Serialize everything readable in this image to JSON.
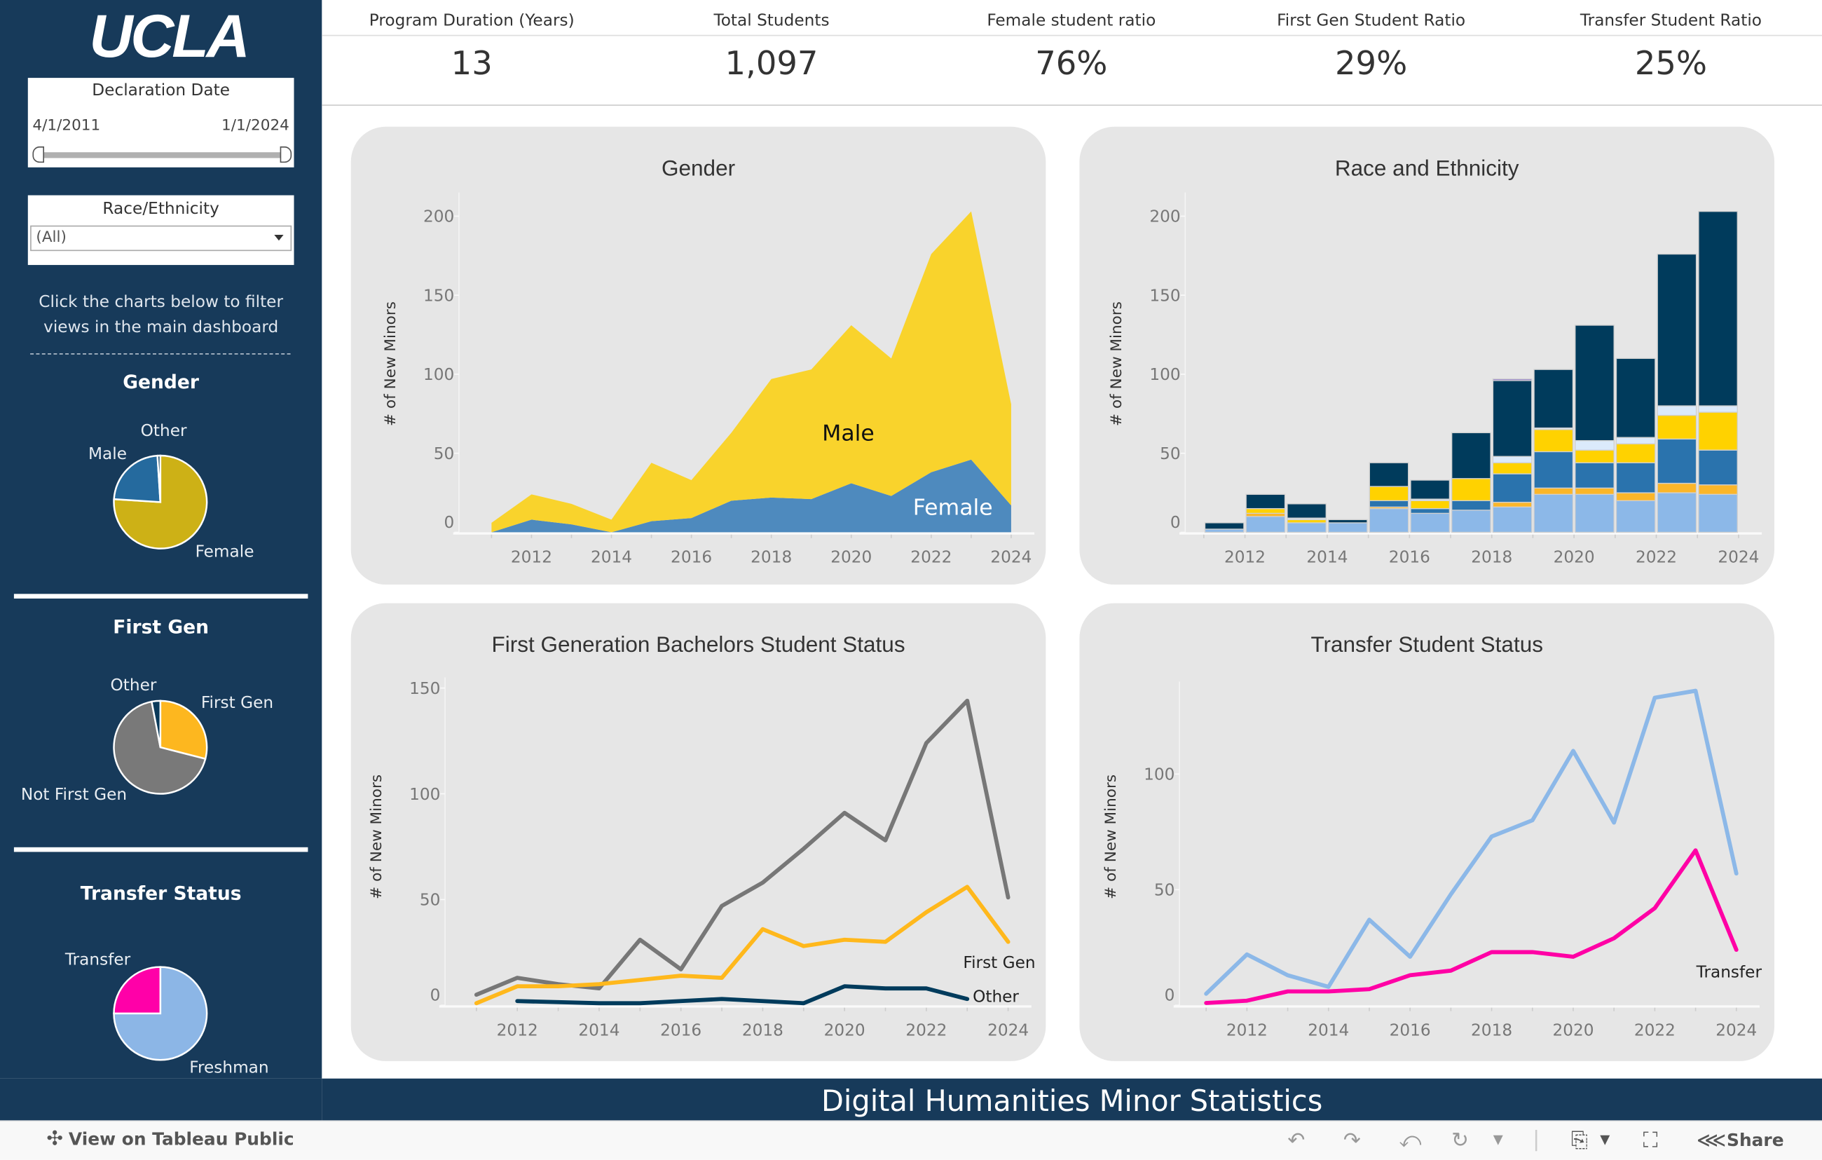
{
  "sidebar": {
    "logo": "UCLA",
    "declaration_filter": {
      "title": "Declaration Date",
      "start": "4/1/2011",
      "end": "1/1/2024"
    },
    "race_filter": {
      "title": "Race/Ethnicity",
      "value": "(All)"
    },
    "hint_line1": "Click the charts below to filter",
    "hint_line2": "views in the main dashboard",
    "gender_pie": {
      "title": "Gender",
      "slices": [
        {
          "label": "Female",
          "value": 76,
          "color": "#cdb116"
        },
        {
          "label": "Male",
          "value": 23,
          "color": "#256a9e"
        },
        {
          "label": "Other",
          "value": 1,
          "color": "#0a3a5a"
        }
      ]
    },
    "firstgen_pie": {
      "title": "First Gen",
      "slices": [
        {
          "label": "First Gen",
          "value": 29,
          "color": "#fdb71f"
        },
        {
          "label": "Not First Gen",
          "value": 68,
          "color": "#797979"
        },
        {
          "label": "Other",
          "value": 3,
          "color": "#0a3a5a"
        }
      ]
    },
    "transfer_pie": {
      "title": "Transfer Status",
      "slices": [
        {
          "label": "Freshman",
          "value": 75,
          "color": "#8cb6e6"
        },
        {
          "label": "Transfer",
          "value": 25,
          "color": "#ff00a8"
        }
      ]
    }
  },
  "kpis": [
    {
      "label": "Program Duration (Years)",
      "value": "13"
    },
    {
      "label": "Total Students",
      "value": "1,097"
    },
    {
      "label": "Female student ratio",
      "value": "76%"
    },
    {
      "label": "First Gen Student Ratio",
      "value": "29%"
    },
    {
      "label": "Transfer Student Ratio",
      "value": "25%"
    }
  ],
  "chart_data": [
    {
      "title": "Gender",
      "type": "area",
      "stacked": true,
      "ylabel": "# of New Minors",
      "ylim": [
        0,
        215
      ],
      "yticks": [
        "0",
        "50",
        "100",
        "150",
        "200"
      ],
      "xticks": [
        "2012",
        "2014",
        "2016",
        "2018",
        "2020",
        "2022",
        "2024"
      ],
      "x": [
        2011,
        2012,
        2013,
        2014,
        2015,
        2016,
        2017,
        2018,
        2019,
        2020,
        2021,
        2022,
        2023,
        2024
      ],
      "series": [
        {
          "name": "Male",
          "color": "#4e8abe",
          "values": [
            0,
            8,
            5,
            0,
            7,
            9,
            20,
            22,
            21,
            31,
            23,
            38,
            46,
            17
          ]
        },
        {
          "name": "Female",
          "color": "#f9d32c",
          "values": [
            6,
            16,
            13,
            8,
            37,
            24,
            43,
            75,
            82,
            100,
            87,
            138,
            157,
            64
          ]
        }
      ]
    },
    {
      "title": "Race and Ethnicity",
      "type": "bar",
      "stacked": true,
      "ylabel": "# of New Minors",
      "ylim": [
        0,
        215
      ],
      "yticks": [
        "0",
        "50",
        "100",
        "150",
        "200"
      ],
      "xticks": [
        "2012",
        "2014",
        "2016",
        "2018",
        "2020",
        "2022",
        "2024"
      ],
      "categories": [
        2011,
        2012,
        2013,
        2014,
        2015,
        2016,
        2017,
        2018,
        2019,
        2020,
        2021,
        2022,
        2023
      ],
      "series": [
        {
          "color": "#8cb8e8",
          "values": [
            2,
            10,
            6,
            6,
            15,
            12,
            14,
            16,
            24,
            24,
            20,
            25,
            24
          ]
        },
        {
          "color": "#fbb629",
          "values": [
            0,
            2,
            0,
            0,
            1,
            0,
            0,
            3,
            4,
            4,
            5,
            6,
            6
          ]
        },
        {
          "color": "#2a73ad",
          "values": [
            0,
            0,
            0,
            0,
            4,
            3,
            6,
            18,
            23,
            16,
            19,
            28,
            22
          ]
        },
        {
          "color": "#ffd200",
          "values": [
            0,
            3,
            2,
            0,
            9,
            5,
            14,
            7,
            14,
            8,
            12,
            15,
            24
          ]
        },
        {
          "color": "#dbeafb",
          "values": [
            0,
            0,
            1,
            0,
            0,
            1,
            0,
            4,
            1,
            6,
            4,
            6,
            4
          ]
        },
        {
          "color": "#003b5c",
          "values": [
            4,
            9,
            9,
            2,
            15,
            12,
            29,
            48,
            37,
            73,
            50,
            96,
            123
          ]
        },
        {
          "color": "#8a74c9",
          "values": [
            0,
            0,
            0,
            0,
            0,
            0,
            0,
            1,
            0,
            0,
            0,
            0,
            0
          ]
        }
      ]
    },
    {
      "title": "First Generation Bachelors Student Status",
      "type": "line",
      "ylabel": "# of New Minors",
      "ylim": [
        0,
        155
      ],
      "yticks": [
        "0",
        "50",
        "100",
        "150"
      ],
      "xticks": [
        "2012",
        "2014",
        "2016",
        "2018",
        "2020",
        "2022",
        "2024"
      ],
      "x": [
        2011,
        2012,
        2013,
        2014,
        2015,
        2016,
        2017,
        2018,
        2019,
        2020,
        2021,
        2022,
        2023,
        2024
      ],
      "series": [
        {
          "color": "#777777",
          "values": [
            5,
            13,
            10,
            8,
            31,
            17,
            47,
            58,
            74,
            91,
            78,
            124,
            144,
            51
          ]
        },
        {
          "name": "First Gen",
          "color": "#ffb81c",
          "values": [
            1,
            9,
            9,
            10,
            12,
            14,
            13,
            36,
            28,
            31,
            30,
            44,
            56,
            30
          ]
        },
        {
          "name": "Other",
          "color": "#003b5c",
          "values": [
            null,
            2,
            1.5,
            1,
            1,
            2,
            3,
            2,
            1,
            9,
            8,
            8,
            3,
            null
          ]
        }
      ]
    },
    {
      "title": "Transfer Student Status",
      "type": "line",
      "ylabel": "# of New Minors",
      "ylim": [
        0,
        140
      ],
      "yticks": [
        "0",
        "50",
        "100"
      ],
      "xticks": [
        "2012",
        "2014",
        "2016",
        "2018",
        "2020",
        "2022",
        "2024"
      ],
      "x": [
        2011,
        2012,
        2013,
        2014,
        2015,
        2016,
        2017,
        2018,
        2019,
        2020,
        2021,
        2022,
        2023,
        2024
      ],
      "series": [
        {
          "color": "#8cb8e8",
          "values": [
            5,
            22,
            13,
            8,
            37,
            21,
            48,
            73,
            80,
            110,
            79,
            133,
            136,
            57
          ]
        },
        {
          "name": "Transfer",
          "color": "#ff00a5",
          "values": [
            1,
            2,
            6,
            6,
            7,
            13,
            15,
            23,
            23,
            21,
            29,
            42,
            67,
            24
          ]
        }
      ]
    }
  ],
  "footer": {
    "title": "Digital Humanities Minor Statistics"
  },
  "toolbar": {
    "view_label": "View on Tableau Public",
    "share_label": "Share"
  }
}
